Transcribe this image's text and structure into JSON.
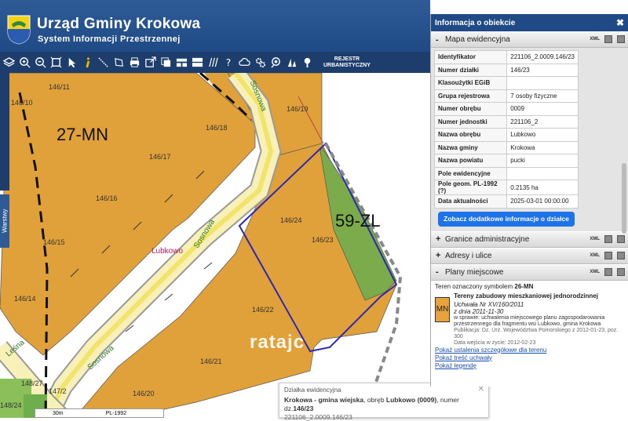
{
  "header": {
    "title": "Urząd Gminy Krokowa",
    "subtitle": "System Informacji Przestrzennej"
  },
  "toolbar": {
    "rejestr_line1": "REJESTR",
    "rejestr_line2": "URBANISTYCZNY",
    "icons": [
      "layers-icon",
      "zoom-in-icon",
      "zoom-out-icon",
      "zoom-extent-icon",
      "pointer-icon",
      "info-icon",
      "measure-line-icon",
      "measure-area-icon",
      "print-icon",
      "export-icon",
      "copy-icon",
      "layout-icon",
      "grid-icon",
      "hatch-icon",
      "help-icon",
      "cloud-icon",
      "settings-icon",
      "search-icon",
      "street-view-icon",
      "location-icon"
    ]
  },
  "map": {
    "zones": [
      "27-MN",
      "59-ZL"
    ],
    "plots": [
      "146/11",
      "146/19",
      "146/17",
      "146/18",
      "146/16",
      "146/23",
      "146/15",
      "146/24",
      "146/14",
      "146/22",
      "146/21",
      "146/20",
      "148/27",
      "147/2",
      "148/24",
      "146/10"
    ],
    "streets": [
      "Sosnowa",
      "Sosnowa",
      "Sosnowa",
      "Leśna"
    ],
    "village": "Lubkowo",
    "warstwy": "Warstwy",
    "scale": "30m",
    "crs": "PL-1992",
    "watermark": "ratajc"
  },
  "popup": {
    "title": "Działka ewidencyjna",
    "line_bold": "Krokowa - gmina wiejska",
    "line_mid": ", obręb ",
    "line_bold2": "Lubkowo (0009)",
    "line_tail": ", numer dz.",
    "line_bold3": "146/23",
    "id": "221106_2.0009.146/23"
  },
  "panel": {
    "title": "Informacja o obiekcie",
    "close": "✖",
    "sections": {
      "mapa": "Mapa ewidencyjna",
      "granice": "Granice administracyjne",
      "adresy": "Adresy i ulice",
      "plany": "Plany miejscowe"
    },
    "xml": "XML",
    "attributes": [
      {
        "k": "Identyfikator",
        "v": "221106_2.0009.146/23"
      },
      {
        "k": "Numer działki",
        "v": "146/23"
      },
      {
        "k": "Klasoużytki EGiB",
        "v": ""
      },
      {
        "k": "Grupa rejestrowa",
        "v": "7 osoby fizyczne"
      },
      {
        "k": "Numer obrębu",
        "v": "0009"
      },
      {
        "k": "Numer jednostki",
        "v": "221106_2"
      },
      {
        "k": "Nazwa obrębu",
        "v": "Lubkowo"
      },
      {
        "k": "Nazwa gminy",
        "v": "Krokowa"
      },
      {
        "k": "Nazwa powiatu",
        "v": "pucki"
      },
      {
        "k": "Pole ewidencyjne",
        "v": ""
      },
      {
        "k": "Pole geom. PL-1992 (?)",
        "v": "0.2135 ha"
      },
      {
        "k": "Data aktualności",
        "v": "2025-03-01 00:00:00"
      }
    ],
    "more_button": "Zobacz dodatkowe informacje o działce",
    "plany": {
      "intro_a": "Teren oznaczony symbolem ",
      "intro_b": "26-MN",
      "badge": "MN",
      "zone_title": "Tereny zabudowy mieszkaniowej jednorodzinnej",
      "uchwala": "Uchwała Nr XV/160/2011",
      "date": "z dnia 2011-11-30",
      "sprawa": "w sprawie: uchwalenia miejscowego planu zagospodarowania przestrzennego dla fragmentu wsi Lubkowo, gmina Krokowa",
      "publikacja": "Publikacja: Dz. Urz. Województwa Pomorskiego z 2012-01-23, poz. 300",
      "wejscie": "Data wejścia w życie: 2012-02-23",
      "link1": "Pokaż ustalenia szczegółowe dla terenu",
      "link2": "Pokaż treść uchwały",
      "link3": "Pokaż legendę"
    }
  }
}
